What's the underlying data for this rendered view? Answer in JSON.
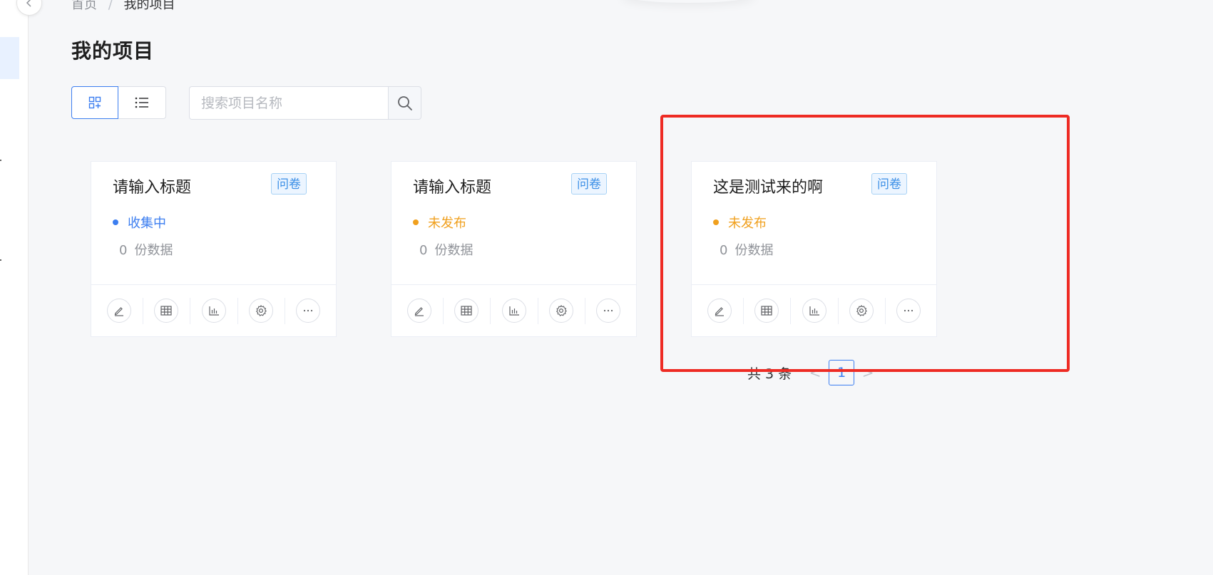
{
  "breadcrumb": {
    "home": "首页",
    "separator": "/",
    "current": "我的项目"
  },
  "page_title": "我的项目",
  "view_toggle": {
    "active": "grid",
    "options": [
      "grid-icon",
      "list-icon"
    ]
  },
  "search": {
    "placeholder": "搜索项目名称",
    "value": ""
  },
  "projects": [
    {
      "title": "请输入标题",
      "tag": "问卷",
      "status": "收集中",
      "status_color": "#3c7ef0",
      "count": "0",
      "count_label": "份数据"
    },
    {
      "title": "请输入标题",
      "tag": "问卷",
      "status": "未发布",
      "status_color": "#f0a01e",
      "count": "0",
      "count_label": "份数据"
    },
    {
      "title": "这是测试来的啊",
      "tag": "问卷",
      "status": "未发布",
      "status_color": "#f0a01e",
      "count": "0",
      "count_label": "份数据"
    }
  ],
  "card_actions": [
    "edit-icon",
    "table-icon",
    "chart-icon",
    "settings-icon",
    "more-icon"
  ],
  "pagination": {
    "total_text": "共 3 条",
    "prev": "<",
    "current_page": "1",
    "next": ">"
  },
  "colors": {
    "accent": "#3c7ef0",
    "highlight": "#ee2b24",
    "tag_text": "#3a8ee6",
    "muted": "#909399"
  }
}
